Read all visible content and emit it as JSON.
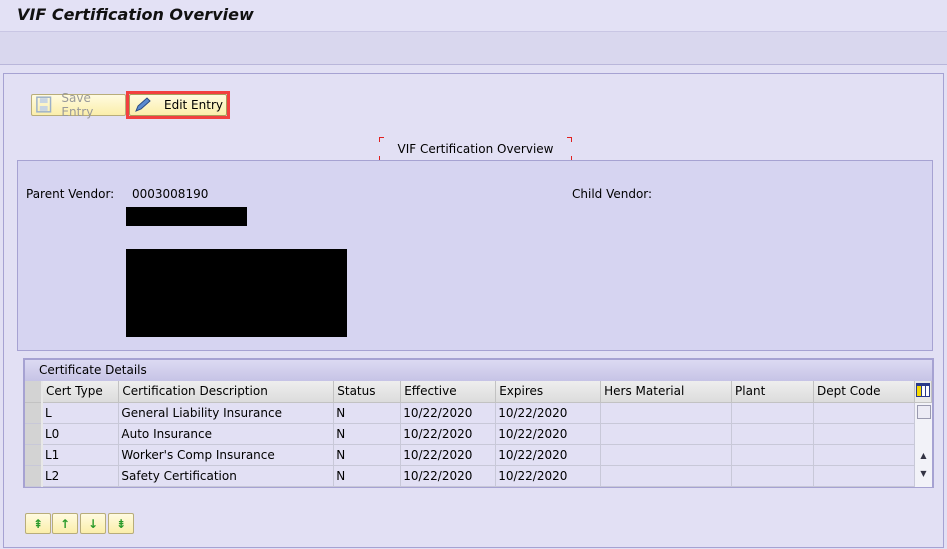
{
  "title": "VIF Certification Overview",
  "buttons": {
    "save": "Save Entry",
    "edit": "Edit Entry"
  },
  "caption": "VIF Certification Overview",
  "vendor": {
    "parent_label": "Parent Vendor:",
    "parent_value": "0003008190",
    "child_label": "Child Vendor:"
  },
  "table": {
    "title": "Certificate Details",
    "columns": [
      "Cert Type",
      "Certification Description",
      "Status",
      "Effective",
      "Expires",
      "Hers Material",
      "Plant",
      "Dept Code"
    ],
    "rows": [
      [
        "L",
        "General Liability Insurance",
        "N",
        "10/22/2020",
        "10/22/2020",
        "",
        "",
        ""
      ],
      [
        "L0",
        "Auto Insurance",
        "N",
        "10/22/2020",
        "10/22/2020",
        "",
        "",
        ""
      ],
      [
        "L1",
        "Worker's Comp Insurance",
        "N",
        "10/22/2020",
        "10/22/2020",
        "",
        "",
        ""
      ],
      [
        "L2",
        "Safety Certification",
        "N",
        "10/22/2020",
        "10/22/2020",
        "",
        "",
        ""
      ]
    ]
  },
  "nav_buttons": [
    "first-page",
    "previous-page",
    "next-page",
    "last-page"
  ]
}
